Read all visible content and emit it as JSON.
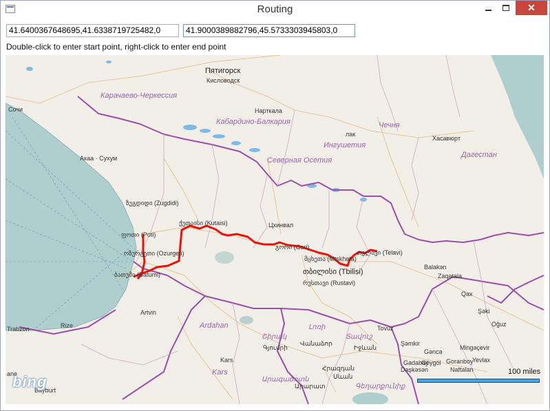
{
  "window": {
    "title": "Routing"
  },
  "inputs": {
    "start_point": "41.6400367648695,41.6338719725482,0",
    "end_point": "41.9000389882796,45.5733303945803,0"
  },
  "instructions": "Double-click to enter start point, right-click to enter end point",
  "map": {
    "logo": "bing",
    "scale_label": "100 miles",
    "route_color": "#e8140c",
    "labels": {
      "pyatigorsk": "Пятигорск",
      "kislovodsk": "Кисловодск",
      "karachay": "Карачаево-Черкессия",
      "nalchik": "Нарткала",
      "kabardino": "Кабардино-Балкария",
      "chechnya": "Чечня",
      "khasavyurt": "Хасавюрт",
      "ingushetia": "Ингушетия",
      "ossetia": "Северная Осетия",
      "dagestan": "Дагестан",
      "lak": "лак",
      "sochi": "Сочи",
      "sukhum": "Акаа · Сухум",
      "zugdidi": "ზუგდიდი (Zugdidi)",
      "kutaisi": "ქუთაისი (Kutaisi)",
      "tskhinval": "Цхинвал",
      "poti": "ფოთი (Poti)",
      "gori": "გორი (Gori)",
      "ozurgeti": "ოზურგეთი (Ozurgeti)",
      "telavi": "თელავი (Telavi)",
      "mtskheta": "მცხეთა (Mtskheta)",
      "batumi": "ბათუმი (Batumi)",
      "tbilisi": "თბილისი (Tbilisi)",
      "rustavi": "რუსთავი (Rustavi)",
      "balakan": "Balakən",
      "zaqatala": "Zaqatala",
      "qax": "Qax",
      "shaki": "Şəki",
      "oguz": "Oğuz",
      "artvin": "Artvin",
      "ardahan": "Ardahan",
      "trabzon": "Trabzon",
      "rize": "Rize",
      "lori": "Լոռի",
      "shirak": "Շիրակ",
      "tavush": "Տավուշ",
      "vanadzor": "Վանաձոր",
      "gyumri": "Գյումրի",
      "ijevan": "Իջևան",
      "tovuz": "Tovuz",
      "shamkir": "Şəmkir",
      "ganja": "Gəncə",
      "dashkasan": "Daşkəsən",
      "gadabay": "Gadabay",
      "goygol": "Göygöl",
      "goranboy": "Goranboy",
      "naftalan": "Naftalan",
      "mingachevir": "Mingəçevir",
      "yevlax": "Yevlax",
      "kars_city": "Kars",
      "kars_region": "Kars",
      "aragatsotn": "Արագածոտն",
      "hrazdan": "Հրազդան",
      "sevan": "Սևան",
      "gegharkunik": "Գեղարքունիք",
      "kotayk": "Արարատ",
      "ane": "ane",
      "bayburt": "Bayburt"
    }
  }
}
